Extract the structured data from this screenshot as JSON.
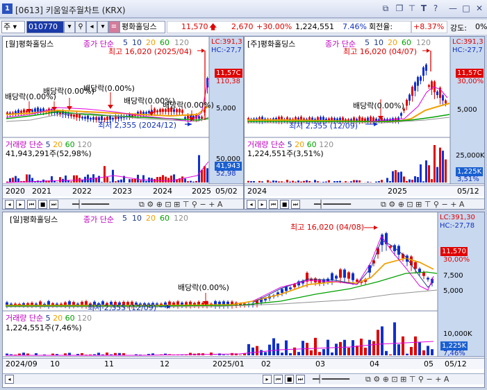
{
  "window": {
    "number": "1",
    "title": "[0613] 키움일주월차트 (KRX)"
  },
  "toolbar": {
    "market_select": "주",
    "code": "010770",
    "stock_name": "평화홀딩스",
    "price": "11,570",
    "change": "2,670",
    "change_pct": "+30.00%",
    "volume": "1,224,551",
    "volume_pct": "7.46%",
    "turnover_label": "회전율:",
    "turnover": "+8.37%",
    "strength_label": "강도:",
    "strength": "0%"
  },
  "monthly": {
    "header": "[월]평화홀딩스",
    "ma_label": "종가 단순",
    "ma_periods": [
      "5",
      "10",
      "20",
      "60",
      "120"
    ],
    "high_label": "최고 16,020 (2025/04)",
    "low_label": "최저 2,355 (2024/12)",
    "lc": "LC:391,3",
    "hc": "HC:-27,7",
    "price_tag": "11,57C",
    "y_upper": "110,38",
    "y_mid": "5,000",
    "dividends": [
      "배당락(0.00%)",
      "배당락(0.00%)",
      "배당락(0.00%)",
      "배당락(0.00%)",
      "배당락(0.00%)",
      "배당락(0.00%)"
    ],
    "vol_label": "거래량",
    "vol_ma": "단순",
    "vol_periods": [
      "5",
      "20",
      "60",
      "120"
    ],
    "vol_value": "41,943,291주(52,98%)",
    "vol_axis_top": "50,000",
    "vol_tag": "41,943",
    "vol_pct": "52,98",
    "x_labels": [
      "2020",
      "2021",
      "2022",
      "2023",
      "2024",
      "2025",
      "05/02"
    ]
  },
  "weekly": {
    "header": "[주]평화홀딩스",
    "ma_label": "종가 단순",
    "ma_periods": [
      "5",
      "10",
      "20",
      "60",
      "120"
    ],
    "high_label": "최고 16,020 (04/07)",
    "low_label": "최저 2,355 (12/09)",
    "lc": "LC:391,3",
    "hc": "HC:-27,7",
    "price_tag": "11,57C",
    "y_upper": "30,00%",
    "y_mid": "5,000",
    "dividend": "배당락(0.00%)",
    "vol_label": "거래량",
    "vol_ma": "단순",
    "vol_periods": [
      "5",
      "20",
      "60",
      "120"
    ],
    "vol_value": "1,224,551주(3,51%)",
    "vol_axis_top": "25,000K",
    "vol_tag": "1,225K",
    "vol_pct": "3,51%",
    "x_labels": [
      "2024",
      "2025",
      "05/12"
    ]
  },
  "daily": {
    "header": "[일]평화홀딩스",
    "ma_label": "종가 단순",
    "ma_periods": [
      "5",
      "10",
      "20",
      "60",
      "120"
    ],
    "high_label": "최고 16,020 (04/08)",
    "low_label": "최저 2,355 (12/09)",
    "lc": "LC:391,30",
    "hc": "HC:-27,78",
    "price_tag": "11,570",
    "y_pct": "30,00%",
    "y_7500": "7,500",
    "y_5000": "5,000",
    "dividend": "배당락(0.00%)",
    "vol_label": "거래량",
    "vol_ma": "단순",
    "vol_periods": [
      "5",
      "20",
      "60",
      "120"
    ],
    "vol_value": "1,224,551주(7,46%)",
    "vol_axis_top": "10,000K",
    "vol_tag": "1,225K",
    "vol_pct": "7,46%",
    "x_labels": [
      "2024/09",
      "10",
      "11",
      "12",
      "2025/01",
      "02",
      "03",
      "04",
      "05",
      "05/12"
    ]
  },
  "colors": {
    "up": "#e00000",
    "down": "#1030d0",
    "ma5": "#e000e0",
    "ma10": "#1a3a8a",
    "ma20": "#f0a000",
    "ma60": "#00a000",
    "ma120": "#909090"
  }
}
